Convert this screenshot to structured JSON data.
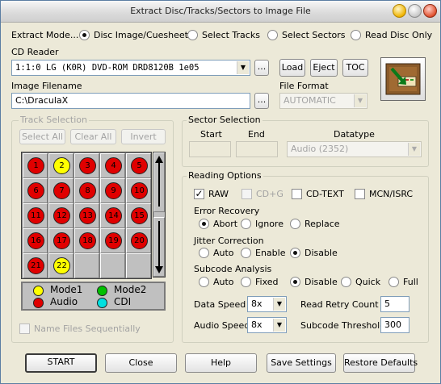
{
  "window": {
    "title": "Extract Disc/Tracks/Sectors to Image File"
  },
  "extract_mode": {
    "label": "Extract Mode...",
    "options": [
      "Disc Image/Cuesheet",
      "Select Tracks",
      "Select Sectors",
      "Read Disc Only"
    ],
    "selected": "Disc Image/Cuesheet"
  },
  "cd_reader": {
    "label": "CD Reader",
    "value": "1:1:0 LG (K0R) DVD-ROM DRD8120B 1e05",
    "browse_label": "...",
    "load_label": "Load",
    "eject_label": "Eject",
    "toc_label": "TOC"
  },
  "image_filename": {
    "label": "Image Filename",
    "value": "C:\\DraculaX",
    "browse_label": "..."
  },
  "file_format": {
    "label": "File Format",
    "value": "AUTOMATIC"
  },
  "track_selection": {
    "title": "Track Selection",
    "select_all_label": "Select All",
    "clear_all_label": "Clear All",
    "invert_label": "Invert",
    "tracks": [
      {
        "n": "1",
        "type": "audio"
      },
      {
        "n": "2",
        "type": "mode1"
      },
      {
        "n": "3",
        "type": "audio"
      },
      {
        "n": "4",
        "type": "audio"
      },
      {
        "n": "5",
        "type": "audio"
      },
      {
        "n": "6",
        "type": "audio"
      },
      {
        "n": "7",
        "type": "audio"
      },
      {
        "n": "8",
        "type": "audio"
      },
      {
        "n": "9",
        "type": "audio"
      },
      {
        "n": "10",
        "type": "audio"
      },
      {
        "n": "11",
        "type": "audio"
      },
      {
        "n": "12",
        "type": "audio"
      },
      {
        "n": "13",
        "type": "audio"
      },
      {
        "n": "14",
        "type": "audio"
      },
      {
        "n": "15",
        "type": "audio"
      },
      {
        "n": "16",
        "type": "audio"
      },
      {
        "n": "17",
        "type": "audio"
      },
      {
        "n": "18",
        "type": "audio"
      },
      {
        "n": "19",
        "type": "audio"
      },
      {
        "n": "20",
        "type": "audio"
      },
      {
        "n": "21",
        "type": "audio"
      },
      {
        "n": "22",
        "type": "mode1"
      }
    ],
    "legend": {
      "mode1": "Mode1",
      "mode2": "Mode2",
      "audio": "Audio",
      "cdi": "CDI"
    },
    "legend_colors": {
      "mode1": "#ffff00",
      "mode2": "#00c000",
      "audio": "#e00000",
      "cdi": "#00e0e0"
    },
    "name_files_label": "Name Files Sequentially"
  },
  "sector_selection": {
    "title": "Sector Selection",
    "start_label": "Start",
    "end_label": "End",
    "datatype_label": "Datatype",
    "datatype_value": "Audio (2352)"
  },
  "reading_options": {
    "title": "Reading Options",
    "raw_label": "RAW",
    "raw_checked": true,
    "cdg_label": "CD+G",
    "cdtext_label": "CD-TEXT",
    "mcn_label": "MCN/ISRC",
    "error_recovery": {
      "label": "Error Recovery",
      "options": [
        "Abort",
        "Ignore",
        "Replace"
      ],
      "selected": "Abort"
    },
    "jitter_correction": {
      "label": "Jitter Correction",
      "options": [
        "Auto",
        "Enable",
        "Disable"
      ],
      "selected": "Disable"
    },
    "subcode_analysis": {
      "label": "Subcode Analysis",
      "options": [
        "Auto",
        "Fixed",
        "Disable",
        "Quick",
        "Full"
      ],
      "selected": "Disable"
    },
    "data_speed": {
      "label": "Data Speed",
      "value": "8x"
    },
    "audio_speed": {
      "label": "Audio Speed",
      "value": "8x"
    },
    "read_retry_count": {
      "label": "Read Retry Count",
      "value": "5"
    },
    "subcode_threshold": {
      "label": "Subcode Threshold",
      "value": "300"
    }
  },
  "buttons": {
    "start": "START",
    "close": "Close",
    "help": "Help",
    "save_settings": "Save Settings",
    "restore_defaults": "Restore Defaults"
  }
}
